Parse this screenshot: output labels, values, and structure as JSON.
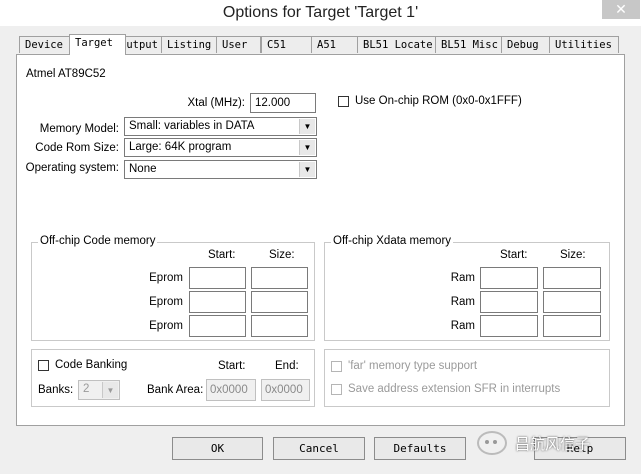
{
  "window": {
    "title": "Options for Target 'Target 1'",
    "close_glyph": "✕"
  },
  "tabs": [
    {
      "label": "Device"
    },
    {
      "label": "Target"
    },
    {
      "label": "Output"
    },
    {
      "label": "Listing"
    },
    {
      "label": "User"
    },
    {
      "label": "C51"
    },
    {
      "label": "A51"
    },
    {
      "label": "BL51 Locate"
    },
    {
      "label": "BL51 Misc"
    },
    {
      "label": "Debug"
    },
    {
      "label": "Utilities"
    }
  ],
  "active_tab": "Target",
  "device_name": "Atmel AT89C52",
  "xtal": {
    "label": "Xtal (MHz):",
    "value": "12.000"
  },
  "onchip_rom": {
    "label": "Use On-chip ROM (0x0-0x1FFF)",
    "checked": false
  },
  "memory_model": {
    "label": "Memory Model:",
    "value": "Small: variables in DATA"
  },
  "code_rom_size": {
    "label": "Code Rom Size:",
    "value": "Large: 64K program"
  },
  "operating_system": {
    "label": "Operating system:",
    "value": "None"
  },
  "offchip_code": {
    "title": "Off-chip Code memory",
    "start_header": "Start:",
    "size_header": "Size:",
    "rows": [
      {
        "label": "Eprom"
      },
      {
        "label": "Eprom"
      },
      {
        "label": "Eprom"
      }
    ]
  },
  "offchip_xdata": {
    "title": "Off-chip Xdata memory",
    "start_header": "Start:",
    "size_header": "Size:",
    "rows": [
      {
        "label": "Ram"
      },
      {
        "label": "Ram"
      },
      {
        "label": "Ram"
      }
    ]
  },
  "code_banking": {
    "label": "Code Banking",
    "checked": false,
    "start_header": "Start:",
    "end_header": "End:",
    "banks_label": "Banks:",
    "banks_value": "2",
    "bank_area_label": "Bank Area:",
    "bank_area_start": "0x0000",
    "bank_area_end": "0x0000"
  },
  "far_memory": {
    "label": "'far' memory type support",
    "checked": false
  },
  "save_sfr": {
    "label": "Save address extension SFR in interrupts",
    "checked": false
  },
  "buttons": {
    "ok": "OK",
    "cancel": "Cancel",
    "defaults": "Defaults",
    "help": "Help"
  },
  "watermark": {
    "text": "昌航风信子"
  },
  "icons": {
    "dropdown": "chevron-down-icon",
    "close": "close-icon"
  },
  "colors": {
    "dialog_bg": "#efefef",
    "panel_bg": "#ffffff",
    "disabled_text": "#9a9a9a"
  }
}
